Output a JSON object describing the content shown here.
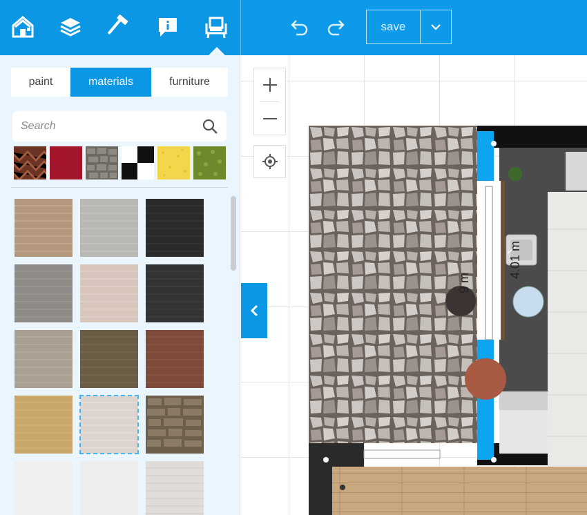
{
  "toolbar": {
    "tools": [
      {
        "name": "house-icon"
      },
      {
        "name": "layers-icon"
      },
      {
        "name": "hammer-icon"
      },
      {
        "name": "info-icon"
      },
      {
        "name": "chair-icon"
      }
    ],
    "save_label": "save",
    "accent": "#0c97e5"
  },
  "panel": {
    "tabs": [
      {
        "label": "paint"
      },
      {
        "label": "materials"
      },
      {
        "label": "furniture"
      }
    ],
    "active_tab": "materials",
    "search": {
      "placeholder": "Search",
      "value": ""
    },
    "recent_swatches": [
      {
        "name": "herringbone-wood",
        "color": "#7a3b2a"
      },
      {
        "name": "red-fabric",
        "color": "#9b1428"
      },
      {
        "name": "grey-cobble",
        "color": "#7d7b74"
      },
      {
        "name": "checker",
        "color": "#111111"
      },
      {
        "name": "yellow-speckle",
        "color": "#f2d64b"
      },
      {
        "name": "green-grass",
        "color": "#6f8a2e"
      }
    ],
    "materials": [
      {
        "name": "beige-brick",
        "color": "#b4987e"
      },
      {
        "name": "light-grey-brick",
        "color": "#b8b8b4"
      },
      {
        "name": "black-brick",
        "color": "#2b2b2b"
      },
      {
        "name": "grey-brick",
        "color": "#8f8b88"
      },
      {
        "name": "pink-brick",
        "color": "#d8c6bd"
      },
      {
        "name": "dark-brick",
        "color": "#333334"
      },
      {
        "name": "tan-stone-brick",
        "color": "#a9a091"
      },
      {
        "name": "olive-brick",
        "color": "#6b5c45"
      },
      {
        "name": "red-brick",
        "color": "#7d4a3c"
      },
      {
        "name": "sand-brick",
        "color": "#c9a66a"
      },
      {
        "name": "white-brick",
        "color": "#ddd3cf"
      },
      {
        "name": "rubble-stone",
        "color": "#6e5f4d"
      },
      {
        "name": "white-plaster",
        "color": "#efefef"
      },
      {
        "name": "white-plaster-2",
        "color": "#eeeeee"
      },
      {
        "name": "white-brick-2",
        "color": "#e0dcd8"
      }
    ]
  },
  "canvas": {
    "dimensions": [
      "4.01 m",
      "9 m"
    ],
    "wall_color": "#0ea5f0"
  }
}
